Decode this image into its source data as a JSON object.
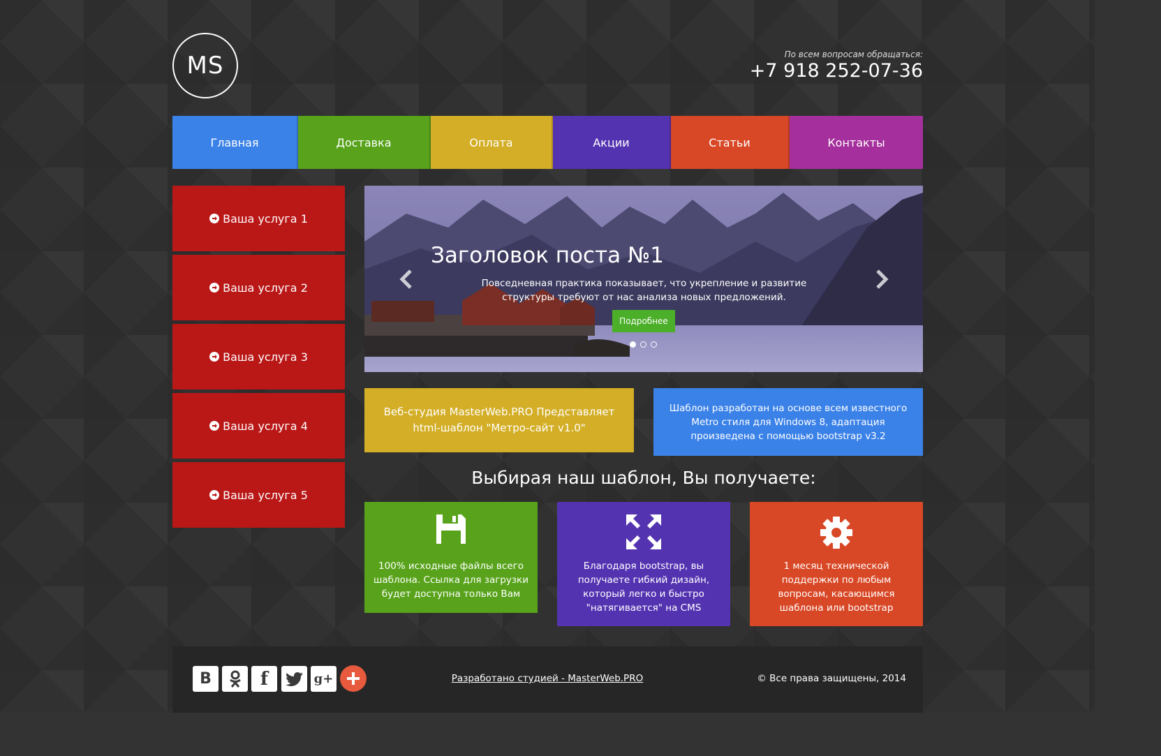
{
  "header": {
    "logo_text": "MS",
    "contact_caption": "По всем вопросам обращаться:",
    "phone": "+7 918 252-07-36"
  },
  "nav": {
    "items": [
      {
        "label": "Главная",
        "color": "#3b82e8"
      },
      {
        "label": "Доставка",
        "color": "#58a31b"
      },
      {
        "label": "Оплата",
        "color": "#d3ae26"
      },
      {
        "label": "Акции",
        "color": "#5433b1"
      },
      {
        "label": "Статьи",
        "color": "#d84826"
      },
      {
        "label": "Контакты",
        "color": "#a52f9c"
      }
    ]
  },
  "services": {
    "color": "#ba1717",
    "items": [
      {
        "label": "Ваша услуга 1"
      },
      {
        "label": "Ваша услуга 2"
      },
      {
        "label": "Ваша услуга 3"
      },
      {
        "label": "Ваша услуга 4"
      },
      {
        "label": "Ваша услуга 5"
      }
    ]
  },
  "slider": {
    "title": "Заголовок поста №1",
    "text": "Повседневная практика показывает, что укрепление и развитие структуры требуют от нас анализа новых предложений.",
    "button_label": "Подробнее",
    "prev_icon": "chevron-left-icon",
    "next_icon": "chevron-right-icon",
    "slide_count": 3,
    "active_slide": 1
  },
  "info": {
    "left": {
      "text": "Веб-студия MasterWeb.PRO Представляет html-шаблон \"Метро-сайт v1.0\"",
      "color": "#d3ae26"
    },
    "right": {
      "text": "Шаблон разработан на основе всем известного Metro стиля для Windows 8, адаптация произведена с помощью bootstrap v3.2",
      "color": "#3b82e8"
    }
  },
  "features": {
    "title": "Выбирая наш шаблон, Вы получаете:",
    "items": [
      {
        "icon": "floppy-disk-icon",
        "text": "100% исходные файлы всего шаблона. Ссылка для загрузки будет доступна только Вам",
        "color": "#58a31b"
      },
      {
        "icon": "fullscreen-icon",
        "text": "Благодаря bootstrap, вы получаете гибкий дизайн, который легко и быстро \"натягивается\" на CMS",
        "color": "#5433b1"
      },
      {
        "icon": "gear-icon",
        "text": "1 месяц технической поддержки по любым вопросам, касающимся шаблона или bootstrap",
        "color": "#d84826"
      }
    ]
  },
  "footer": {
    "social": [
      {
        "icon": "vk-icon",
        "glyph": "B"
      },
      {
        "icon": "odnoklassniki-icon",
        "glyph": "ok"
      },
      {
        "icon": "facebook-icon",
        "glyph": "f"
      },
      {
        "icon": "twitter-icon",
        "glyph": "t"
      },
      {
        "icon": "google-plus-icon",
        "glyph": "g+"
      },
      {
        "icon": "add-share-icon",
        "glyph": "+"
      }
    ],
    "credit_link": "Разработано студией - MasterWeb.PRO",
    "copyright": "© Все права защищены, 2014"
  }
}
